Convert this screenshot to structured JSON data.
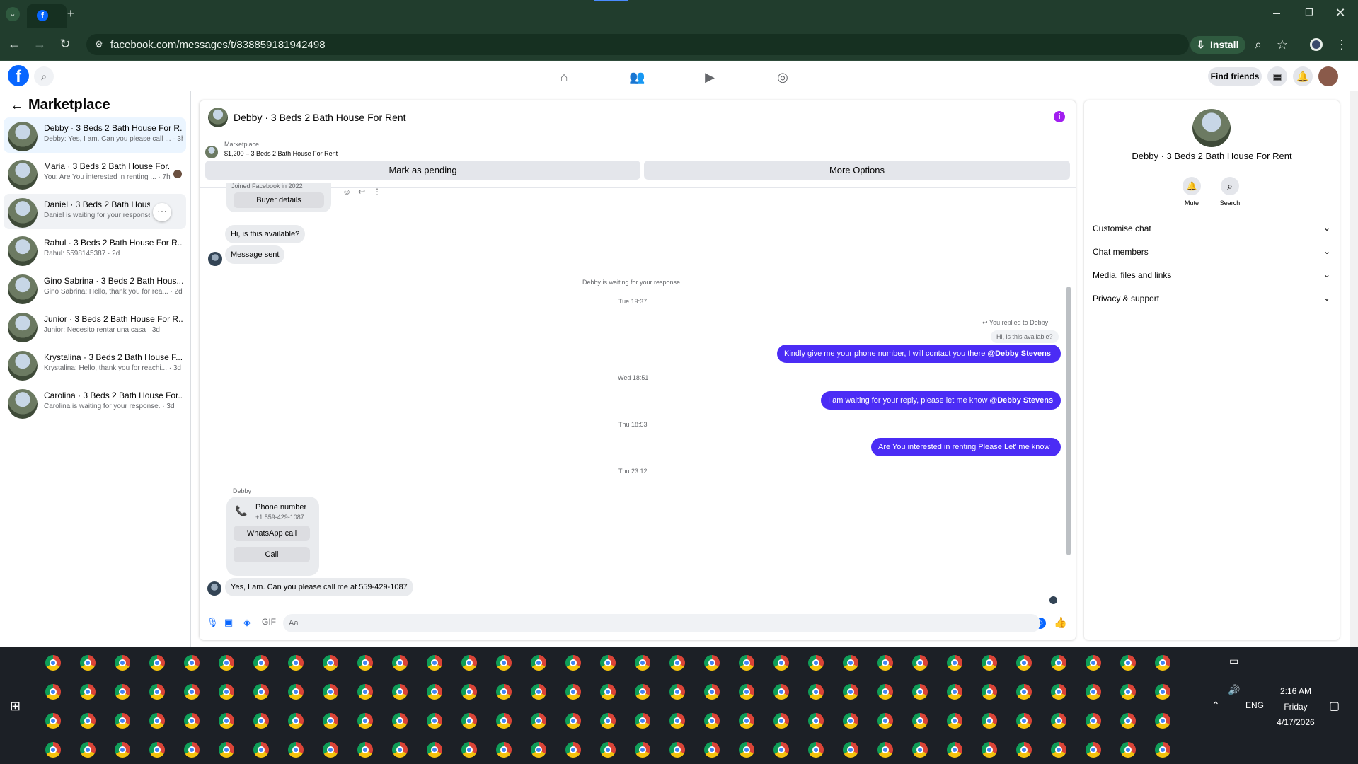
{
  "browser": {
    "url": "facebook.com/messages/t/838859181942498",
    "install_label": "Install"
  },
  "header": {
    "find_friends": "Find friends"
  },
  "sidebar": {
    "title": "Marketplace",
    "conversations": [
      {
        "title": "Debby · 3 Beds 2 Bath House For R...",
        "snippet": "Debby: Yes, I am. Can you please call ... · 3h"
      },
      {
        "title": "Maria · 3 Beds 2 Bath House For...",
        "snippet": "You: Are You interested in renting ... · 7h"
      },
      {
        "title": "Daniel · 3 Beds 2 Bath House F...",
        "snippet": "Daniel is waiting for your response."
      },
      {
        "title": "Rahul · 3 Beds 2 Bath House For R...",
        "snippet": "Rahul: 5598145387 · 2d"
      },
      {
        "title": "Gino Sabrina · 3 Beds 2 Bath Hous...",
        "snippet": "Gino Sabrina: Hello, thank you for rea... · 2d"
      },
      {
        "title": "Junior · 3 Beds 2 Bath House For R...",
        "snippet": "Junior: Necesito rentar una casa · 3d"
      },
      {
        "title": "Krystalina · 3 Beds 2 Bath House F...",
        "snippet": "Krystalina: Hello, thank you for reachi... · 3d"
      },
      {
        "title": "Carolina · 3 Beds 2 Bath House For...",
        "snippet": "Carolina is waiting for your response. · 3d"
      }
    ]
  },
  "chat": {
    "title": "Debby · 3 Beds 2 Bath House For Rent",
    "pinned_label": "Marketplace",
    "pinned_listing": "$1,200 – 3 Beds 2 Bath House For Rent",
    "mark_pending": "Mark as pending",
    "more_options": "More Options",
    "joined": "Joined Facebook in 2022",
    "buyer_details": "Buyer details",
    "msg_available": "Hi, is this available?",
    "msg_sent": "Message sent",
    "waiting": "Debby is waiting for your response.",
    "ts1": "Tue 19:37",
    "replied_to": "You replied to Debby",
    "quoted": "Hi, is this available?",
    "out1": "Kindly give me your phone number, I will contact you there",
    "mention": "@Debby Stevens",
    "ts2": "Wed 18:51",
    "out2": "I am waiting for your reply, please let me know",
    "ts3": "Thu 18:53",
    "out3": "Are You  interested in renting Please Let' me know",
    "ts4": "Thu 23:12",
    "sender": "Debby",
    "phone_label": "Phone number",
    "phone_value": "+1 559-429-1087",
    "whatsapp": "WhatsApp call",
    "call": "Call",
    "in_last": "Yes, I am. Can you please call me at 559-429-1087",
    "composer_placeholder": "Aa"
  },
  "right": {
    "title": "Debby · 3 Beds 2 Bath House For Rent",
    "mute": "Mute",
    "search": "Search",
    "sections": [
      "Customise chat",
      "Chat members",
      "Media, files and links",
      "Privacy & support"
    ]
  },
  "taskbar": {
    "time": "2:16 AM",
    "day": "Friday",
    "date": "4/17/2026",
    "lang": "ENG"
  },
  "colors": {
    "accent": "#4b2cf5",
    "fb_blue": "#0866ff",
    "chrome_bg": "#213d2d"
  }
}
